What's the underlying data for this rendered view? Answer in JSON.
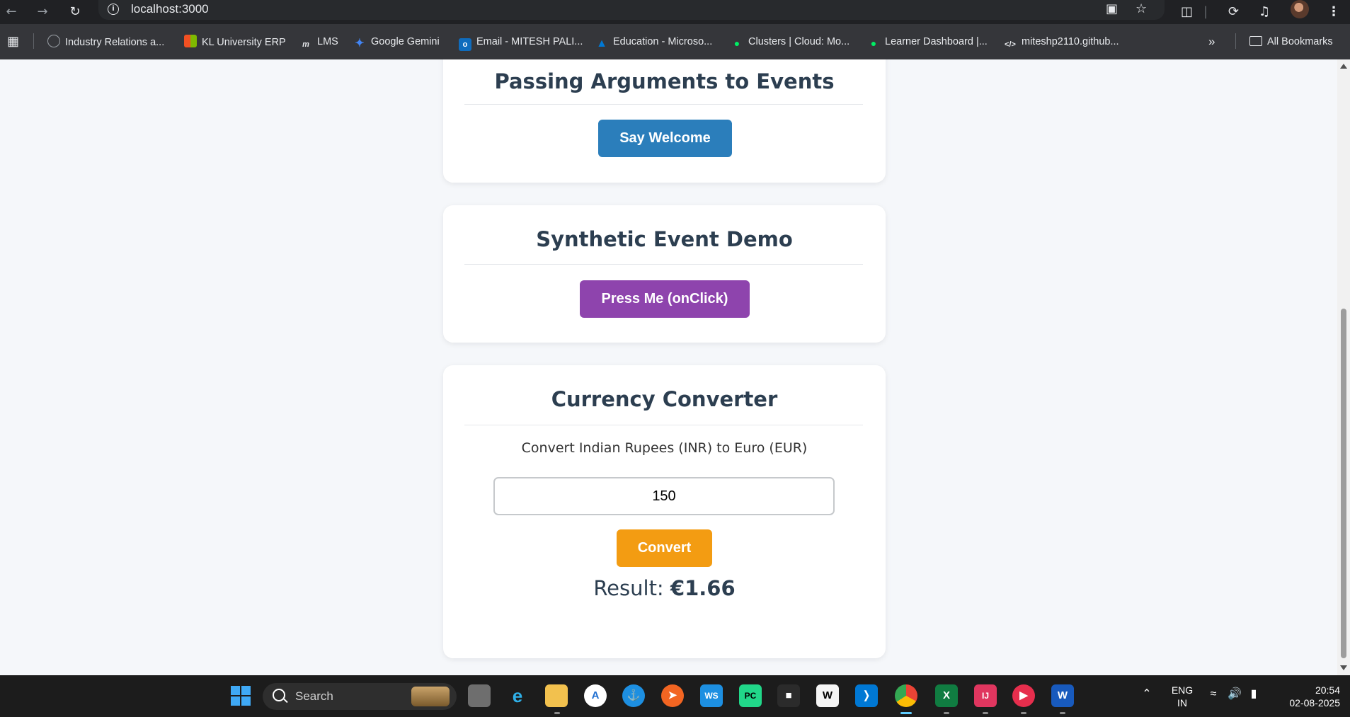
{
  "browser": {
    "url": "localhost:3000",
    "bookmarks": [
      {
        "label": "Industry Relations a...",
        "icon": "globe-icon",
        "color": "#9aa0a6"
      },
      {
        "label": "KL University ERP",
        "icon": "windows-grid-icon",
        "color": "#f25022"
      },
      {
        "label": "LMS",
        "icon": "moodle-icon",
        "color": "#e8eaed"
      },
      {
        "label": "Google Gemini",
        "icon": "gemini-icon",
        "color": "#4285f4"
      },
      {
        "label": "Email - MITESH PALI...",
        "icon": "outlook-icon",
        "color": "#0f6cbd"
      },
      {
        "label": "Education - Microso...",
        "icon": "azure-icon",
        "color": "#0078d4"
      },
      {
        "label": "Clusters | Cloud: Mo...",
        "icon": "mongodb-leaf-icon",
        "color": "#00ed64"
      },
      {
        "label": "Learner Dashboard |...",
        "icon": "mongodb-leaf-icon",
        "color": "#00ed64"
      },
      {
        "label": "miteshp2110.github...",
        "icon": "code-icon",
        "color": "#e8eaed"
      }
    ],
    "all_bookmarks": "All Bookmarks"
  },
  "page": {
    "passing": {
      "title": "Passing Arguments to Events",
      "button": "Say Welcome"
    },
    "synthetic": {
      "title": "Synthetic Event Demo",
      "button": "Press Me (onClick)"
    },
    "currency": {
      "title": "Currency Converter",
      "description": "Convert Indian Rupees (INR) to Euro (EUR)",
      "amount": "150",
      "button": "Convert",
      "result_label": "Result:",
      "result_value": "€1.66"
    }
  },
  "taskbar": {
    "search_label": "Search",
    "language": "ENG",
    "region": "IN",
    "time": "20:54",
    "date": "02-08-2025"
  },
  "colors": {
    "primary_button": "#2b7ebb",
    "purple_button": "#8e44ad",
    "orange_button": "#f39c12",
    "heading": "#2c3e50"
  }
}
